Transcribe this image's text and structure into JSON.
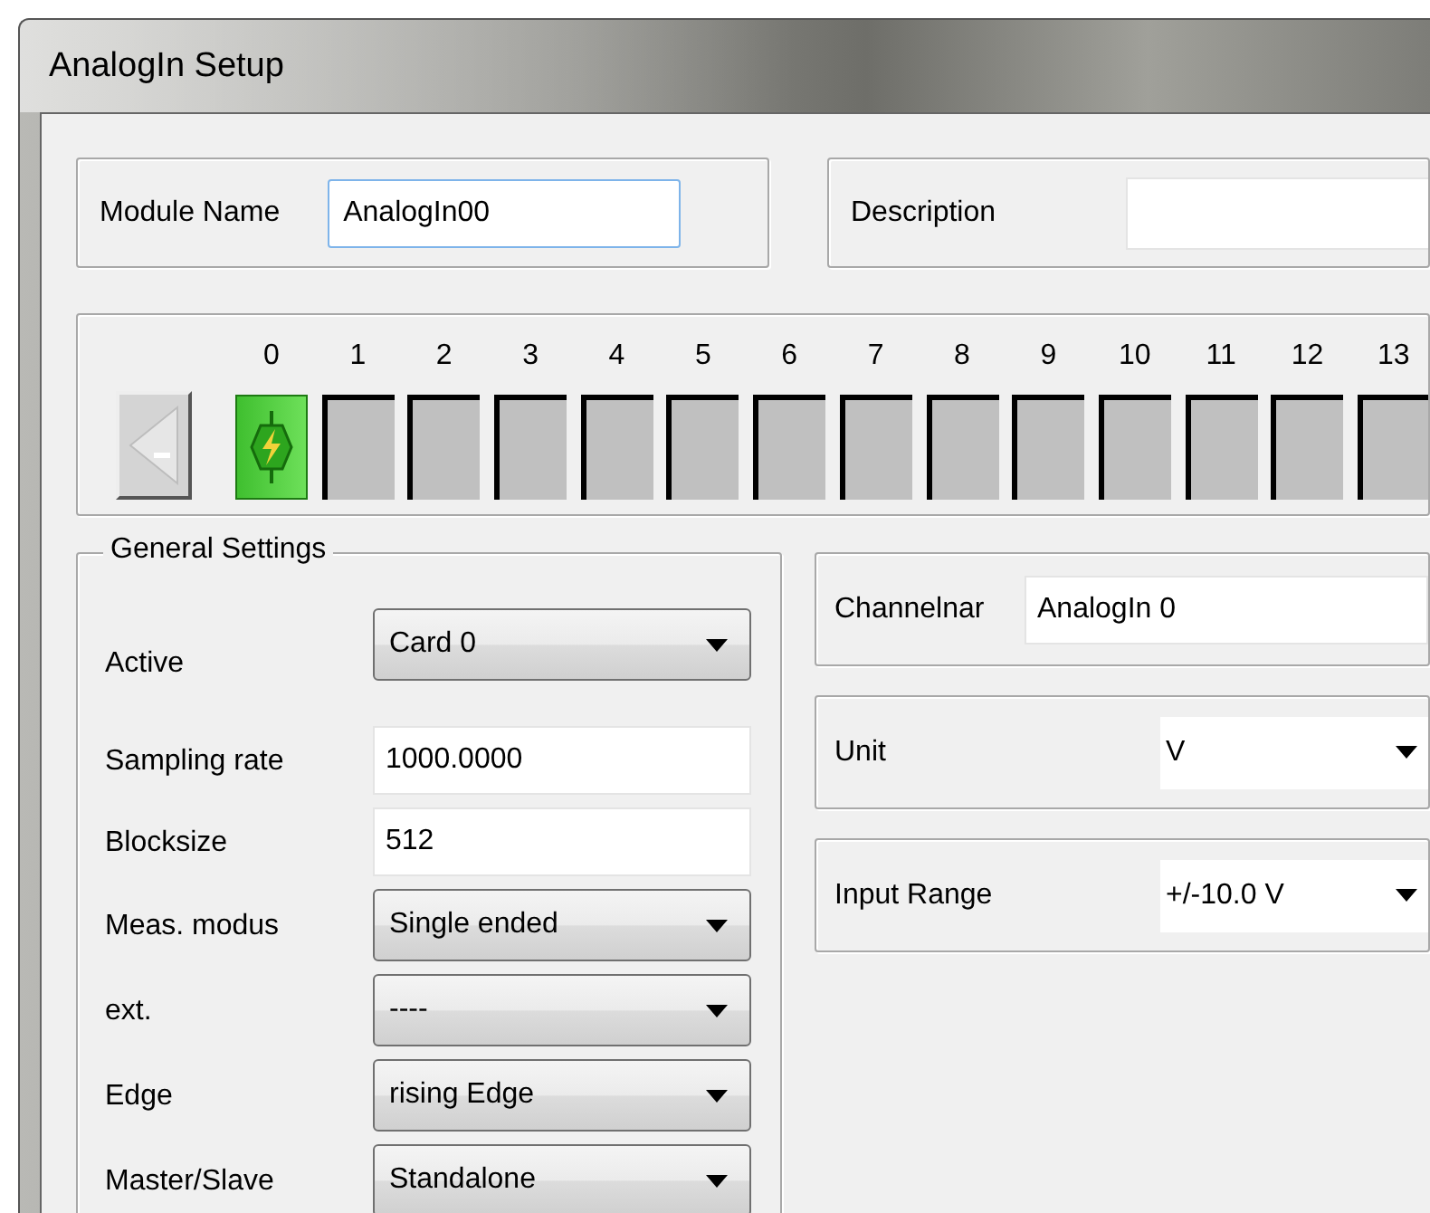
{
  "window": {
    "title": "AnalogIn Setup"
  },
  "module_name": {
    "label": "Module Name",
    "value": "AnalogIn00"
  },
  "description": {
    "label": "Description"
  },
  "channels": [
    {
      "label": "0",
      "active": true
    },
    {
      "label": "1",
      "active": false
    },
    {
      "label": "2",
      "active": false
    },
    {
      "label": "3",
      "active": false
    },
    {
      "label": "4",
      "active": false
    },
    {
      "label": "5",
      "active": false
    },
    {
      "label": "6",
      "active": false
    },
    {
      "label": "7",
      "active": false
    },
    {
      "label": "8",
      "active": false
    },
    {
      "label": "9",
      "active": false
    },
    {
      "label": "10",
      "active": false
    },
    {
      "label": "11",
      "active": false
    },
    {
      "label": "12",
      "active": false
    },
    {
      "label": "13",
      "active": false
    }
  ],
  "general_settings": {
    "title": "General Settings",
    "rows": [
      {
        "kind": "dropdown",
        "label": "Active",
        "value": "Card 0"
      },
      {
        "kind": "text",
        "label": "Sampling rate",
        "value": "1000.0000"
      },
      {
        "kind": "text",
        "label": "Blocksize",
        "value": "512"
      },
      {
        "kind": "dropdown",
        "label": "Meas. modus",
        "value": "Single ended"
      },
      {
        "kind": "dropdown",
        "label": "ext.",
        "value": "----"
      },
      {
        "kind": "dropdown",
        "label": "Edge",
        "value": "rising Edge"
      },
      {
        "kind": "dropdown",
        "label": "Master/Slave",
        "value": "Standalone"
      }
    ]
  },
  "channel_settings": [
    {
      "kind": "text",
      "label": "Channelnar",
      "value": "AnalogIn 0"
    },
    {
      "kind": "dropdown",
      "label": "Unit",
      "value": "V"
    },
    {
      "kind": "dropdown",
      "label": "Input Range",
      "value": "+/-10.0 V"
    }
  ]
}
